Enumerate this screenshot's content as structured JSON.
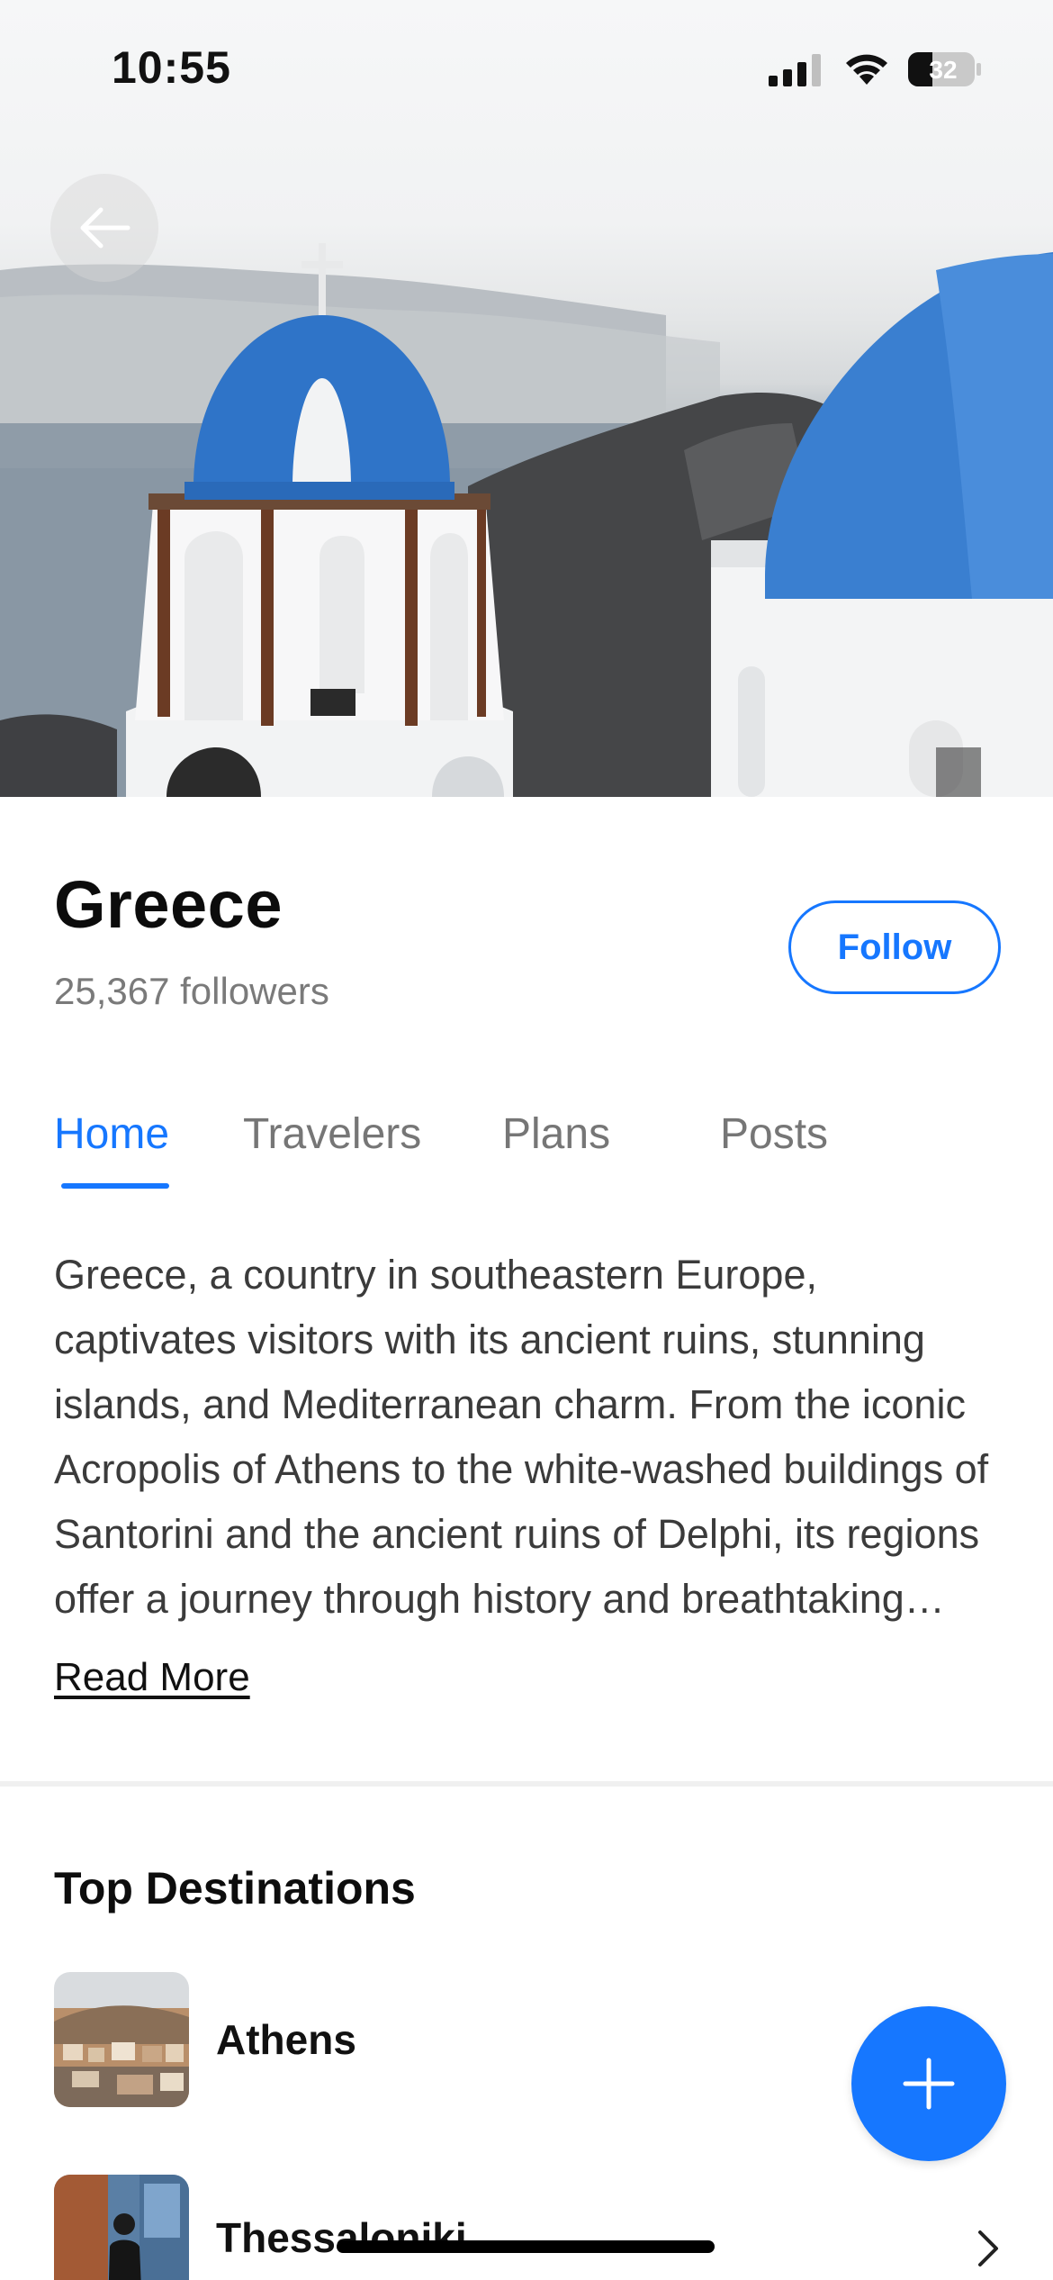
{
  "status_bar": {
    "time": "10:55",
    "battery_level": "32",
    "icons": [
      "signal-icon",
      "wifi-icon",
      "battery-icon"
    ]
  },
  "hero": {
    "back_icon": "arrow-left-icon"
  },
  "header": {
    "title": "Greece",
    "followers": "25,367 followers",
    "follow_label": "Follow"
  },
  "tabs": [
    {
      "label": "Home",
      "active": true
    },
    {
      "label": "Travelers",
      "active": false
    },
    {
      "label": "Plans",
      "active": false
    },
    {
      "label": "Posts",
      "active": false
    }
  ],
  "about": {
    "text": "Greece, a country in southeastern Europe, captivates visitors with its ancient ruins, stunning islands, and Mediterranean charm. From the iconic Acropolis of Athens to the white-washed buildings of Santorini and the ancient ruins of Delphi, its regions offer a journey through history and breathtaking landscapes.",
    "read_more_label": "Read More"
  },
  "top_destinations": {
    "title": "Top Destinations",
    "items": [
      {
        "name": "Athens"
      },
      {
        "name": "Thessaloniki"
      }
    ]
  },
  "fab": {
    "icon": "plus-icon"
  },
  "colors": {
    "accent": "#1677ff",
    "dome_blue": "#3a7fd0",
    "text_primary": "#111111",
    "text_secondary": "#7a7a7a"
  }
}
